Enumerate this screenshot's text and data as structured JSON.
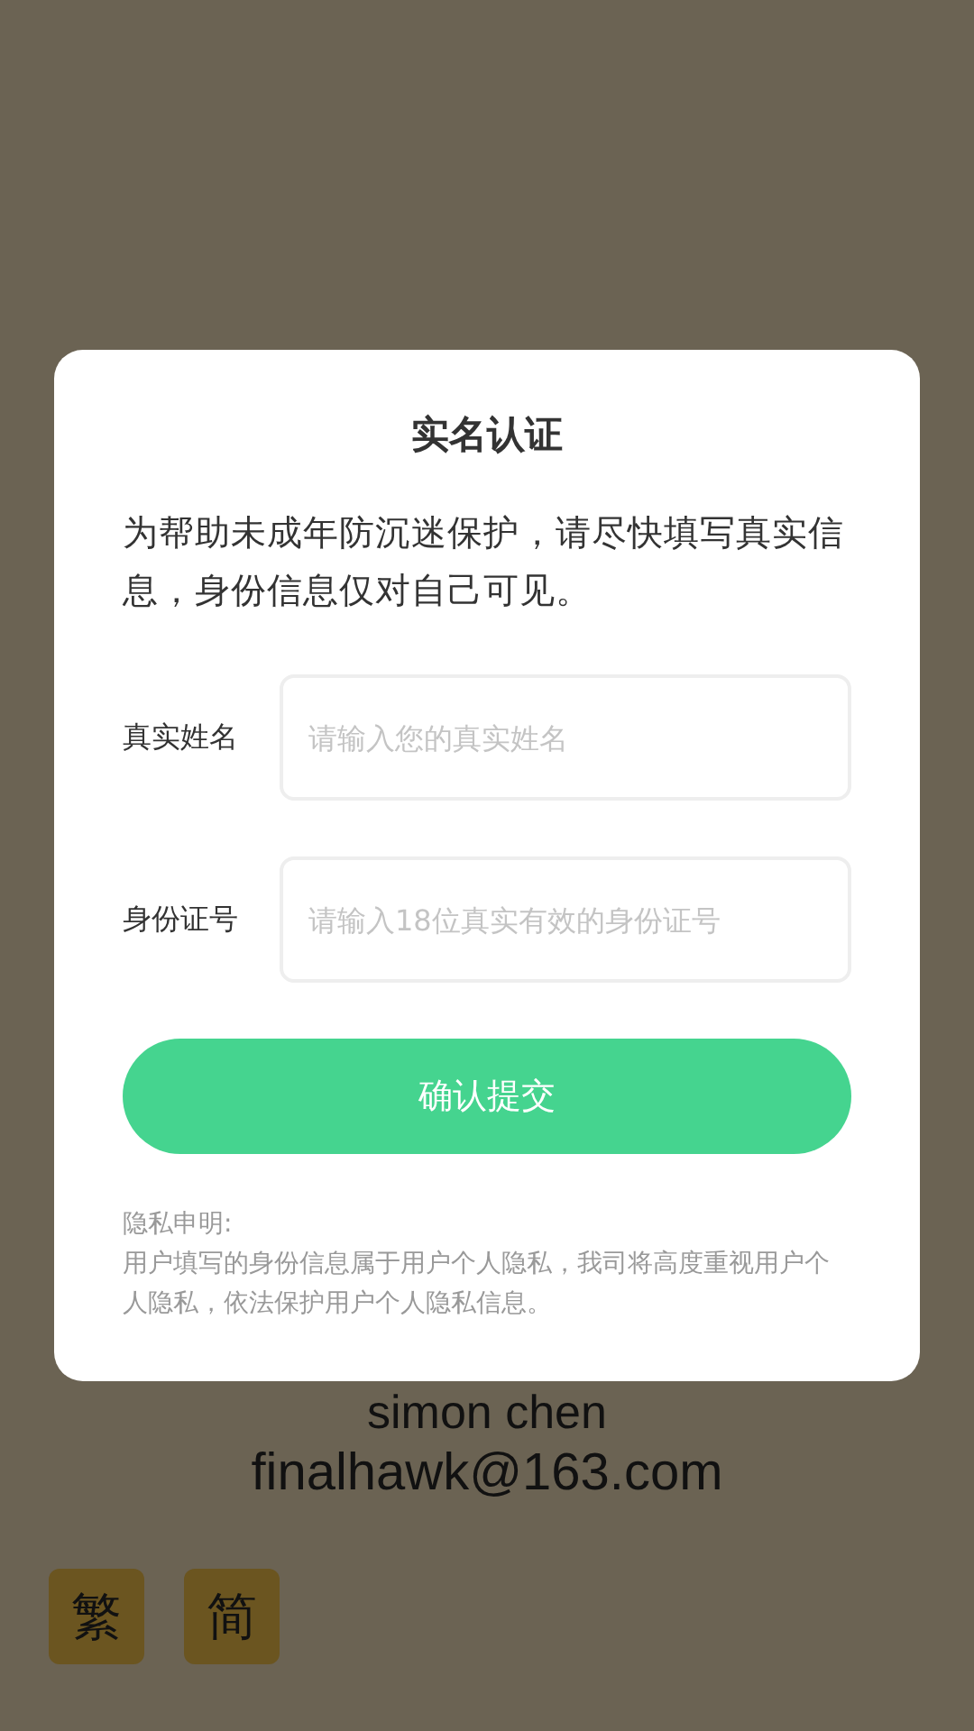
{
  "background": {
    "name": "simon chen",
    "email": "finalhawk@163.com",
    "language_buttons": [
      {
        "label": "繁"
      },
      {
        "label": "简"
      }
    ]
  },
  "dialog": {
    "title": "实名认证",
    "description": "为帮助未成年防沉迷保护，请尽快填写真实信息，身份信息仅对自己可见。",
    "fields": [
      {
        "label": "真实姓名",
        "placeholder": "请输入您的真实姓名"
      },
      {
        "label": "身份证号",
        "placeholder": "请输入18位真实有效的身份证号"
      }
    ],
    "submit": "确认提交",
    "privacy_title": "隐私申明:",
    "privacy_text": "用户填写的身份信息属于用户个人隐私，我司将高度重视用户个人隐私，依法保护用户个人隐私信息。"
  }
}
